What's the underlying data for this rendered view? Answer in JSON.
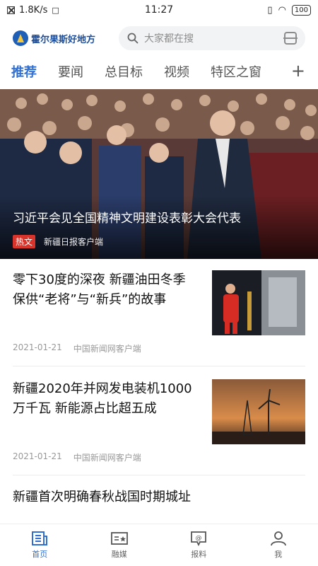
{
  "status_bar": {
    "speed": "1.8K/s",
    "time": "11:27",
    "battery": "100"
  },
  "header": {
    "logo_text": "霍尔果斯好地方",
    "search_placeholder": "大家都在搜"
  },
  "tabs": [
    {
      "label": "推荐"
    },
    {
      "label": "要闻"
    },
    {
      "label": "总目标"
    },
    {
      "label": "视频"
    },
    {
      "label": "特区之窗"
    }
  ],
  "hero": {
    "title": "习近平会见全国精神文明建设表彰大会代表",
    "badge": "热文",
    "source": "新疆日报客户端"
  },
  "news": [
    {
      "title": "零下30度的深夜 新疆油田冬季保供“老将”与“新兵”的故事",
      "date": "2021-01-21",
      "source": "中国新闻网客户端"
    },
    {
      "title": "新疆2020年并网发电装机1000万千瓦 新能源占比超五成",
      "date": "2021-01-21",
      "source": "中国新闻网客户端"
    },
    {
      "title": "新疆首次明确春秋战国时期城址"
    }
  ],
  "bottom_nav": [
    {
      "label": "首页",
      "icon": "home-news-icon"
    },
    {
      "label": "融媒",
      "icon": "media-icon"
    },
    {
      "label": "报料",
      "icon": "report-icon"
    },
    {
      "label": "我",
      "icon": "profile-icon"
    }
  ],
  "colors": {
    "accent": "#2f6fd1",
    "badge": "#d9342c"
  }
}
